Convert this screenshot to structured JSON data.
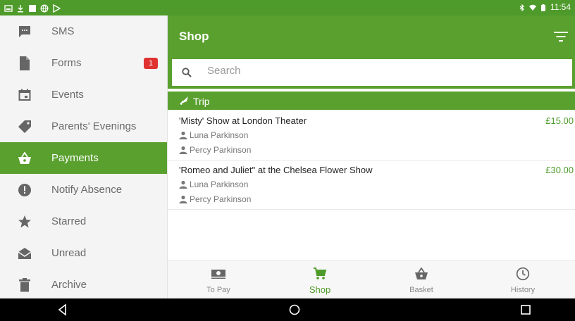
{
  "status_bar": {
    "time": "11:54",
    "left_icons": [
      "image-icon",
      "download-icon",
      "square-icon",
      "globe-icon",
      "play-store-icon"
    ],
    "right_icons": [
      "bluetooth-icon",
      "wifi-icon",
      "battery-icon"
    ]
  },
  "drawer": {
    "items": [
      {
        "label": "SMS",
        "icon": "sms-icon"
      },
      {
        "label": "Forms",
        "icon": "document-icon",
        "badge": "1"
      },
      {
        "label": "Events",
        "icon": "calendar-icon"
      },
      {
        "label": "Parents' Evenings",
        "icon": "tag-icon"
      },
      {
        "label": "Payments",
        "icon": "basket-icon",
        "active": true
      },
      {
        "label": "Notify Absence",
        "icon": "alert-icon"
      },
      {
        "label": "Starred",
        "icon": "star-icon"
      },
      {
        "label": "Unread",
        "icon": "envelope-open-icon"
      },
      {
        "label": "Archive",
        "icon": "trash-icon"
      }
    ]
  },
  "app_bar": {
    "title": "Shop",
    "filter_icon": "filter-icon"
  },
  "search": {
    "placeholder": "Search",
    "value": ""
  },
  "section": {
    "label": "Trip",
    "icon": "trip-icon"
  },
  "list": [
    {
      "title": "'Misty' Show at London Theater",
      "price": "£15.00",
      "people": [
        "Luna Parkinson",
        "Percy Parkinson"
      ]
    },
    {
      "title": "'Romeo and Juliet\" at the Chelsea Flower Show",
      "price": "£30.00",
      "people": [
        "Luna Parkinson",
        "Percy Parkinson"
      ]
    }
  ],
  "bottom_nav": {
    "tabs": [
      {
        "label": "To Pay",
        "icon": "cash-icon"
      },
      {
        "label": "Shop",
        "icon": "cart-icon",
        "active": true
      },
      {
        "label": "Basket",
        "icon": "basket-icon"
      },
      {
        "label": "History",
        "icon": "clock-icon"
      }
    ]
  },
  "colors": {
    "primary": "#5aa02f",
    "status_bar": "#4e9a2a",
    "badge": "#e03131",
    "drawer_bg": "#f4f4f4"
  }
}
